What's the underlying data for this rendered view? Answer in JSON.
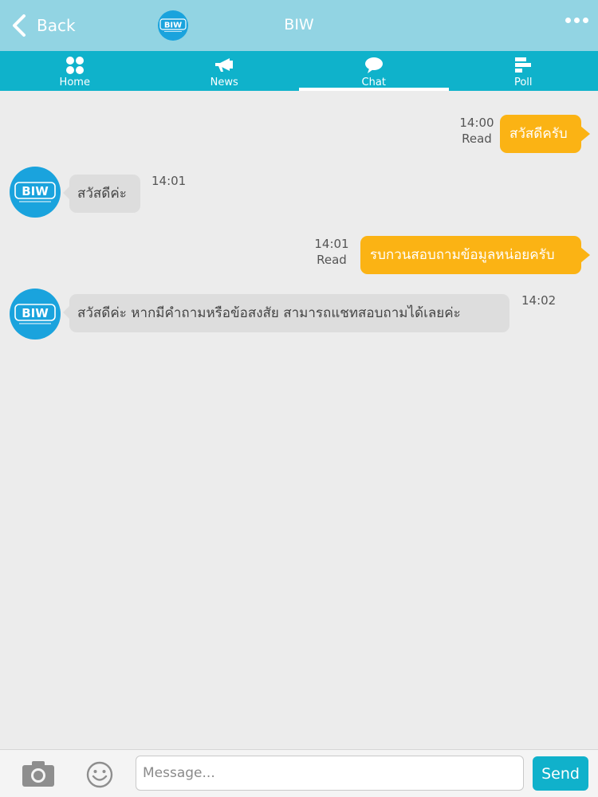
{
  "header": {
    "back_label": "Back",
    "title": "BIW",
    "logo_text": "BIW"
  },
  "nav": {
    "items": [
      {
        "label": "Home",
        "icon": "grid-icon"
      },
      {
        "label": "News",
        "icon": "megaphone-icon"
      },
      {
        "label": "Chat",
        "icon": "speech-bubble-icon",
        "active": true
      },
      {
        "label": "Poll",
        "icon": "bar-chart-icon"
      }
    ]
  },
  "messages": [
    {
      "direction": "outgoing",
      "text": "สวัสดีครับ",
      "time": "14:00",
      "status": "Read"
    },
    {
      "direction": "incoming",
      "text": "สวัสดีค่ะ",
      "time": "14:01"
    },
    {
      "direction": "outgoing",
      "text": "รบกวนสอบถามข้อมูลหน่อยครับ",
      "time": "14:01",
      "status": "Read"
    },
    {
      "direction": "incoming",
      "text": "สวัสดีค่ะ หากมีคำถามหรือข้อสงสัย สามารถแชทสอบถามได้เลยค่ะ",
      "time": "14:02"
    }
  ],
  "composer": {
    "placeholder": "Message...",
    "value": "",
    "send_label": "Send"
  },
  "colors": {
    "header_bg": "#92d4e3",
    "nav_bg": "#0fb2cb",
    "outgoing_bubble": "#fbb314",
    "incoming_bubble": "#dddddd",
    "logo_blue": "#1aa3dd"
  }
}
